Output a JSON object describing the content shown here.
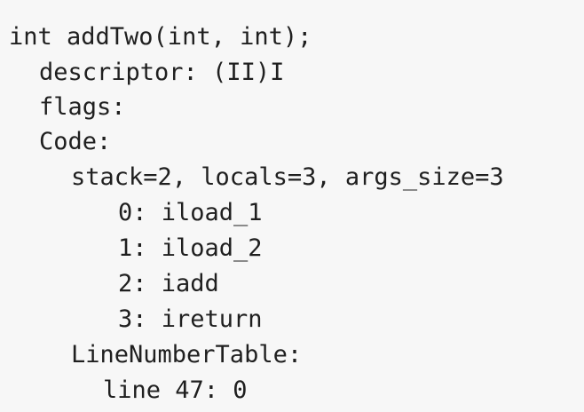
{
  "method": {
    "signature": "int addTwo(int, int);",
    "descriptor": "descriptor: (II)I",
    "flags": "flags:",
    "code_label": "Code:",
    "stack_info": "stack=2, locals=3, args_size=3",
    "instructions": [
      "0: iload_1",
      "1: iload_2",
      "2: iadd",
      "3: ireturn"
    ],
    "line_number_table_label": "LineNumberTable:",
    "line_entries": [
      "line 47: 0"
    ]
  }
}
